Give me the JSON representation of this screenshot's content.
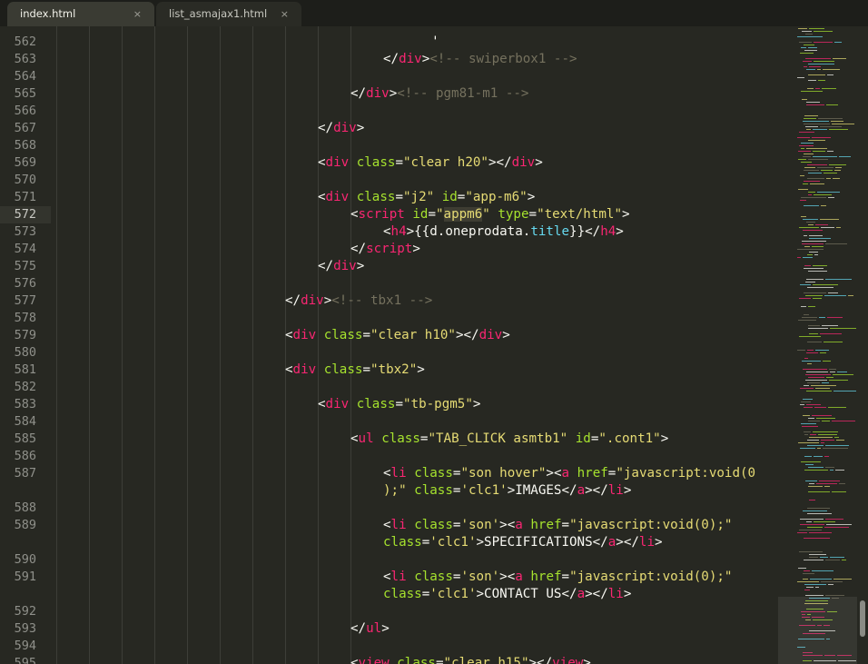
{
  "tabs": [
    {
      "label": "index.html",
      "active": true,
      "close_glyph": "×"
    },
    {
      "label": "list_asmajax1.html",
      "active": false,
      "close_glyph": "×"
    }
  ],
  "editor": {
    "current_line": "572",
    "lines": [
      {
        "num": "562",
        "indent": 11,
        "segments": [
          {
            "c": "p",
            "t": "  ' "
          }
        ]
      },
      {
        "num": "563",
        "indent": 10,
        "segments": [
          {
            "c": "p",
            "t": "</"
          },
          {
            "c": "t",
            "t": "div"
          },
          {
            "c": "p",
            "t": ">"
          },
          {
            "c": "c",
            "t": "<!-- swiperbox1 -->"
          }
        ]
      },
      {
        "num": "564",
        "indent": 0,
        "segments": []
      },
      {
        "num": "565",
        "indent": 9,
        "segments": [
          {
            "c": "p",
            "t": "</"
          },
          {
            "c": "t",
            "t": "div"
          },
          {
            "c": "p",
            "t": ">"
          },
          {
            "c": "c",
            "t": "<!-- pgm81-m1 -->"
          }
        ]
      },
      {
        "num": "566",
        "indent": 0,
        "segments": []
      },
      {
        "num": "567",
        "indent": 8,
        "segments": [
          {
            "c": "p",
            "t": "</"
          },
          {
            "c": "t",
            "t": "div"
          },
          {
            "c": "p",
            "t": ">"
          }
        ]
      },
      {
        "num": "568",
        "indent": 0,
        "segments": []
      },
      {
        "num": "569",
        "indent": 8,
        "segments": [
          {
            "c": "p",
            "t": "<"
          },
          {
            "c": "t",
            "t": "div"
          },
          {
            "c": "p",
            "t": " "
          },
          {
            "c": "a",
            "t": "class"
          },
          {
            "c": "p",
            "t": "="
          },
          {
            "c": "s",
            "t": "\"clear h20\""
          },
          {
            "c": "p",
            "t": "></"
          },
          {
            "c": "t",
            "t": "div"
          },
          {
            "c": "p",
            "t": ">"
          }
        ]
      },
      {
        "num": "570",
        "indent": 0,
        "segments": []
      },
      {
        "num": "571",
        "indent": 8,
        "segments": [
          {
            "c": "p",
            "t": "<"
          },
          {
            "c": "t",
            "t": "div"
          },
          {
            "c": "p",
            "t": " "
          },
          {
            "c": "a",
            "t": "class"
          },
          {
            "c": "p",
            "t": "="
          },
          {
            "c": "s",
            "t": "\"j2\""
          },
          {
            "c": "p",
            "t": " "
          },
          {
            "c": "a",
            "t": "id"
          },
          {
            "c": "p",
            "t": "="
          },
          {
            "c": "s",
            "t": "\"app-m6\""
          },
          {
            "c": "p",
            "t": ">"
          }
        ]
      },
      {
        "num": "572",
        "indent": 9,
        "segments": [
          {
            "c": "p",
            "t": "<"
          },
          {
            "c": "t",
            "t": "script"
          },
          {
            "c": "p",
            "t": " "
          },
          {
            "c": "a",
            "t": "id"
          },
          {
            "c": "p",
            "t": "="
          },
          {
            "c": "s",
            "t": "\""
          },
          {
            "c": "s hl",
            "t": "appm6"
          },
          {
            "c": "s",
            "t": "\""
          },
          {
            "c": "p",
            "t": " "
          },
          {
            "c": "a",
            "t": "type"
          },
          {
            "c": "p",
            "t": "="
          },
          {
            "c": "s",
            "t": "\"text/html\""
          },
          {
            "c": "p",
            "t": ">"
          }
        ]
      },
      {
        "num": "573",
        "indent": 10,
        "segments": [
          {
            "c": "p",
            "t": "<"
          },
          {
            "c": "t",
            "t": "h4"
          },
          {
            "c": "p",
            "t": ">{{d.oneprodata."
          },
          {
            "c": "v",
            "t": "title"
          },
          {
            "c": "p",
            "t": "}}</"
          },
          {
            "c": "t",
            "t": "h4"
          },
          {
            "c": "p",
            "t": ">"
          }
        ]
      },
      {
        "num": "574",
        "indent": 9,
        "segments": [
          {
            "c": "p",
            "t": "</"
          },
          {
            "c": "t",
            "t": "script"
          },
          {
            "c": "p",
            "t": ">"
          }
        ]
      },
      {
        "num": "575",
        "indent": 8,
        "segments": [
          {
            "c": "p",
            "t": "</"
          },
          {
            "c": "t",
            "t": "div"
          },
          {
            "c": "p",
            "t": ">"
          }
        ]
      },
      {
        "num": "576",
        "indent": 0,
        "segments": []
      },
      {
        "num": "577",
        "indent": 7,
        "segments": [
          {
            "c": "p",
            "t": "</"
          },
          {
            "c": "t",
            "t": "div"
          },
          {
            "c": "p",
            "t": ">"
          },
          {
            "c": "c",
            "t": "<!-- tbx1 -->"
          }
        ]
      },
      {
        "num": "578",
        "indent": 0,
        "segments": []
      },
      {
        "num": "579",
        "indent": 7,
        "segments": [
          {
            "c": "p",
            "t": "<"
          },
          {
            "c": "t",
            "t": "div"
          },
          {
            "c": "p",
            "t": " "
          },
          {
            "c": "a",
            "t": "class"
          },
          {
            "c": "p",
            "t": "="
          },
          {
            "c": "s",
            "t": "\"clear h10\""
          },
          {
            "c": "p",
            "t": "></"
          },
          {
            "c": "t",
            "t": "div"
          },
          {
            "c": "p",
            "t": ">"
          }
        ]
      },
      {
        "num": "580",
        "indent": 0,
        "segments": []
      },
      {
        "num": "581",
        "indent": 7,
        "segments": [
          {
            "c": "p",
            "t": "<"
          },
          {
            "c": "t",
            "t": "div"
          },
          {
            "c": "p",
            "t": " "
          },
          {
            "c": "a",
            "t": "class"
          },
          {
            "c": "p",
            "t": "="
          },
          {
            "c": "s",
            "t": "\"tbx2\""
          },
          {
            "c": "p",
            "t": ">"
          }
        ]
      },
      {
        "num": "582",
        "indent": 0,
        "segments": []
      },
      {
        "num": "583",
        "indent": 8,
        "segments": [
          {
            "c": "p",
            "t": "<"
          },
          {
            "c": "t",
            "t": "div"
          },
          {
            "c": "p",
            "t": " "
          },
          {
            "c": "a",
            "t": "class"
          },
          {
            "c": "p",
            "t": "="
          },
          {
            "c": "s",
            "t": "\"tb-pgm5\""
          },
          {
            "c": "p",
            "t": ">"
          }
        ]
      },
      {
        "num": "584",
        "indent": 0,
        "segments": []
      },
      {
        "num": "585",
        "indent": 9,
        "segments": [
          {
            "c": "p",
            "t": "<"
          },
          {
            "c": "t",
            "t": "ul"
          },
          {
            "c": "p",
            "t": " "
          },
          {
            "c": "a",
            "t": "class"
          },
          {
            "c": "p",
            "t": "="
          },
          {
            "c": "s",
            "t": "\"TAB_CLICK asmtb1\""
          },
          {
            "c": "p",
            "t": " "
          },
          {
            "c": "a",
            "t": "id"
          },
          {
            "c": "p",
            "t": "="
          },
          {
            "c": "s",
            "t": "\".cont1\""
          },
          {
            "c": "p",
            "t": ">"
          }
        ]
      },
      {
        "num": "586",
        "indent": 0,
        "segments": []
      },
      {
        "num": "587",
        "indent": 10,
        "segments": [
          {
            "c": "p",
            "t": "<"
          },
          {
            "c": "t",
            "t": "li"
          },
          {
            "c": "p",
            "t": " "
          },
          {
            "c": "a",
            "t": "class"
          },
          {
            "c": "p",
            "t": "="
          },
          {
            "c": "s",
            "t": "\"son hover\""
          },
          {
            "c": "p",
            "t": "><"
          },
          {
            "c": "t",
            "t": "a"
          },
          {
            "c": "p",
            "t": " "
          },
          {
            "c": "a",
            "t": "href"
          },
          {
            "c": "p",
            "t": "="
          },
          {
            "c": "s",
            "t": "\"javascript:void(0"
          }
        ]
      },
      {
        "num": "",
        "indent": 10,
        "segments": [
          {
            "c": "s",
            "t": ");\""
          },
          {
            "c": "p",
            "t": " "
          },
          {
            "c": "a",
            "t": "class"
          },
          {
            "c": "p",
            "t": "="
          },
          {
            "c": "s",
            "t": "'clc1'"
          },
          {
            "c": "p",
            "t": ">IMAGES</"
          },
          {
            "c": "t",
            "t": "a"
          },
          {
            "c": "p",
            "t": "></"
          },
          {
            "c": "t",
            "t": "li"
          },
          {
            "c": "p",
            "t": ">"
          }
        ]
      },
      {
        "num": "588",
        "indent": 0,
        "segments": []
      },
      {
        "num": "589",
        "indent": 10,
        "segments": [
          {
            "c": "p",
            "t": "<"
          },
          {
            "c": "t",
            "t": "li"
          },
          {
            "c": "p",
            "t": " "
          },
          {
            "c": "a",
            "t": "class"
          },
          {
            "c": "p",
            "t": "="
          },
          {
            "c": "s",
            "t": "'son'"
          },
          {
            "c": "p",
            "t": "><"
          },
          {
            "c": "t",
            "t": "a"
          },
          {
            "c": "p",
            "t": " "
          },
          {
            "c": "a",
            "t": "href"
          },
          {
            "c": "p",
            "t": "="
          },
          {
            "c": "s",
            "t": "\"javascript:void(0);\""
          }
        ]
      },
      {
        "num": "",
        "indent": 10,
        "segments": [
          {
            "c": "a",
            "t": "class"
          },
          {
            "c": "p",
            "t": "="
          },
          {
            "c": "s",
            "t": "'clc1'"
          },
          {
            "c": "p",
            "t": ">SPECIFICATIONS</"
          },
          {
            "c": "t",
            "t": "a"
          },
          {
            "c": "p",
            "t": "></"
          },
          {
            "c": "t",
            "t": "li"
          },
          {
            "c": "p",
            "t": ">"
          }
        ]
      },
      {
        "num": "590",
        "indent": 0,
        "segments": []
      },
      {
        "num": "591",
        "indent": 10,
        "segments": [
          {
            "c": "p",
            "t": "<"
          },
          {
            "c": "t",
            "t": "li"
          },
          {
            "c": "p",
            "t": " "
          },
          {
            "c": "a",
            "t": "class"
          },
          {
            "c": "p",
            "t": "="
          },
          {
            "c": "s",
            "t": "'son'"
          },
          {
            "c": "p",
            "t": "><"
          },
          {
            "c": "t",
            "t": "a"
          },
          {
            "c": "p",
            "t": " "
          },
          {
            "c": "a",
            "t": "href"
          },
          {
            "c": "p",
            "t": "="
          },
          {
            "c": "s",
            "t": "\"javascript:void(0);\""
          }
        ]
      },
      {
        "num": "",
        "indent": 10,
        "segments": [
          {
            "c": "a",
            "t": "class"
          },
          {
            "c": "p",
            "t": "="
          },
          {
            "c": "s",
            "t": "'clc1'"
          },
          {
            "c": "p",
            "t": ">CONTACT US</"
          },
          {
            "c": "t",
            "t": "a"
          },
          {
            "c": "p",
            "t": "></"
          },
          {
            "c": "t",
            "t": "li"
          },
          {
            "c": "p",
            "t": ">"
          }
        ]
      },
      {
        "num": "592",
        "indent": 0,
        "segments": []
      },
      {
        "num": "593",
        "indent": 9,
        "segments": [
          {
            "c": "p",
            "t": "</"
          },
          {
            "c": "t",
            "t": "ul"
          },
          {
            "c": "p",
            "t": ">"
          }
        ]
      },
      {
        "num": "594",
        "indent": 0,
        "segments": []
      },
      {
        "num": "595",
        "indent": 9,
        "segments": [
          {
            "c": "p",
            "t": "<"
          },
          {
            "c": "t",
            "t": "view"
          },
          {
            "c": "p",
            "t": " "
          },
          {
            "c": "a",
            "t": "class"
          },
          {
            "c": "p",
            "t": "="
          },
          {
            "c": "s",
            "t": "\"clear h15\""
          },
          {
            "c": "p",
            "t": "></"
          },
          {
            "c": "t",
            "t": "view"
          },
          {
            "c": "p",
            "t": ">"
          }
        ]
      }
    ]
  },
  "theme": {
    "background": "#272822",
    "tag": "#f92672",
    "attribute": "#a6e22e",
    "string": "#e6db74",
    "comment": "#75715e",
    "text": "#f8f8f2",
    "property": "#66d9ef"
  }
}
